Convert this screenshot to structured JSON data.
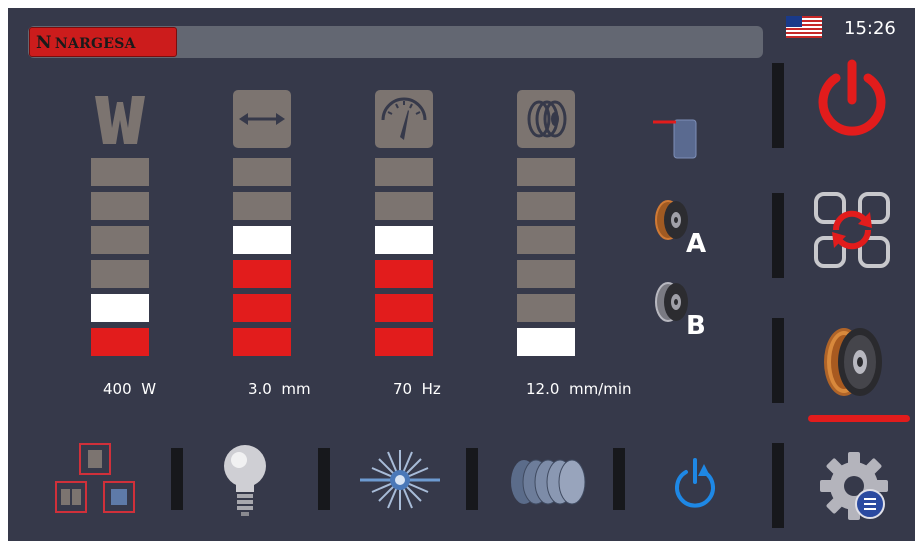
{
  "header": {
    "brand": "NARGESA",
    "brand_initial": "N",
    "time": "15:26",
    "language_flag": "us-flag-icon"
  },
  "meters": [
    {
      "id": "power",
      "icon": "power-w-icon",
      "value": "400",
      "unit": "W",
      "filled_segments": 2,
      "level_fraction": 0.33
    },
    {
      "id": "width",
      "icon": "width-arrows-icon",
      "value": "3.0",
      "unit": "mm",
      "filled_segments": 4,
      "level_fraction": 0.67
    },
    {
      "id": "frequency",
      "icon": "gauge-icon",
      "value": "70",
      "unit": "Hz",
      "filled_segments": 4,
      "level_fraction": 0.6
    },
    {
      "id": "wire_speed",
      "icon": "wire-spool-icon",
      "value": "12.0",
      "unit": "mm/min",
      "filled_segments": 1,
      "level_fraction": 0.17
    }
  ],
  "middle_column": {
    "material_icon": "material-sheet-icon",
    "spool_a_label": "A",
    "spool_b_label": "B"
  },
  "sidebar": {
    "items": [
      {
        "name": "power-button",
        "icon": "power-icon"
      },
      {
        "name": "refresh-button",
        "icon": "refresh-icon"
      },
      {
        "name": "wire-spool-button",
        "icon": "wire-spool-icon",
        "active": true
      },
      {
        "name": "settings-button",
        "icon": "gear-icon"
      }
    ]
  },
  "bottom_bar": {
    "items": [
      {
        "name": "layout-mode-button",
        "icon": "layout-icon"
      },
      {
        "name": "light-button",
        "icon": "light-bulb-icon"
      },
      {
        "name": "laser-button",
        "icon": "laser-burst-icon"
      },
      {
        "name": "oscillation-button",
        "icon": "oscillation-icon"
      },
      {
        "name": "reset-button",
        "icon": "reset-icon"
      }
    ]
  },
  "colors": {
    "background": "#36394a",
    "active_segment": "#e21c1c",
    "current_segment": "#ffffff",
    "inactive_segment": "#7c7470",
    "accent_blue": "#1e88e5"
  }
}
